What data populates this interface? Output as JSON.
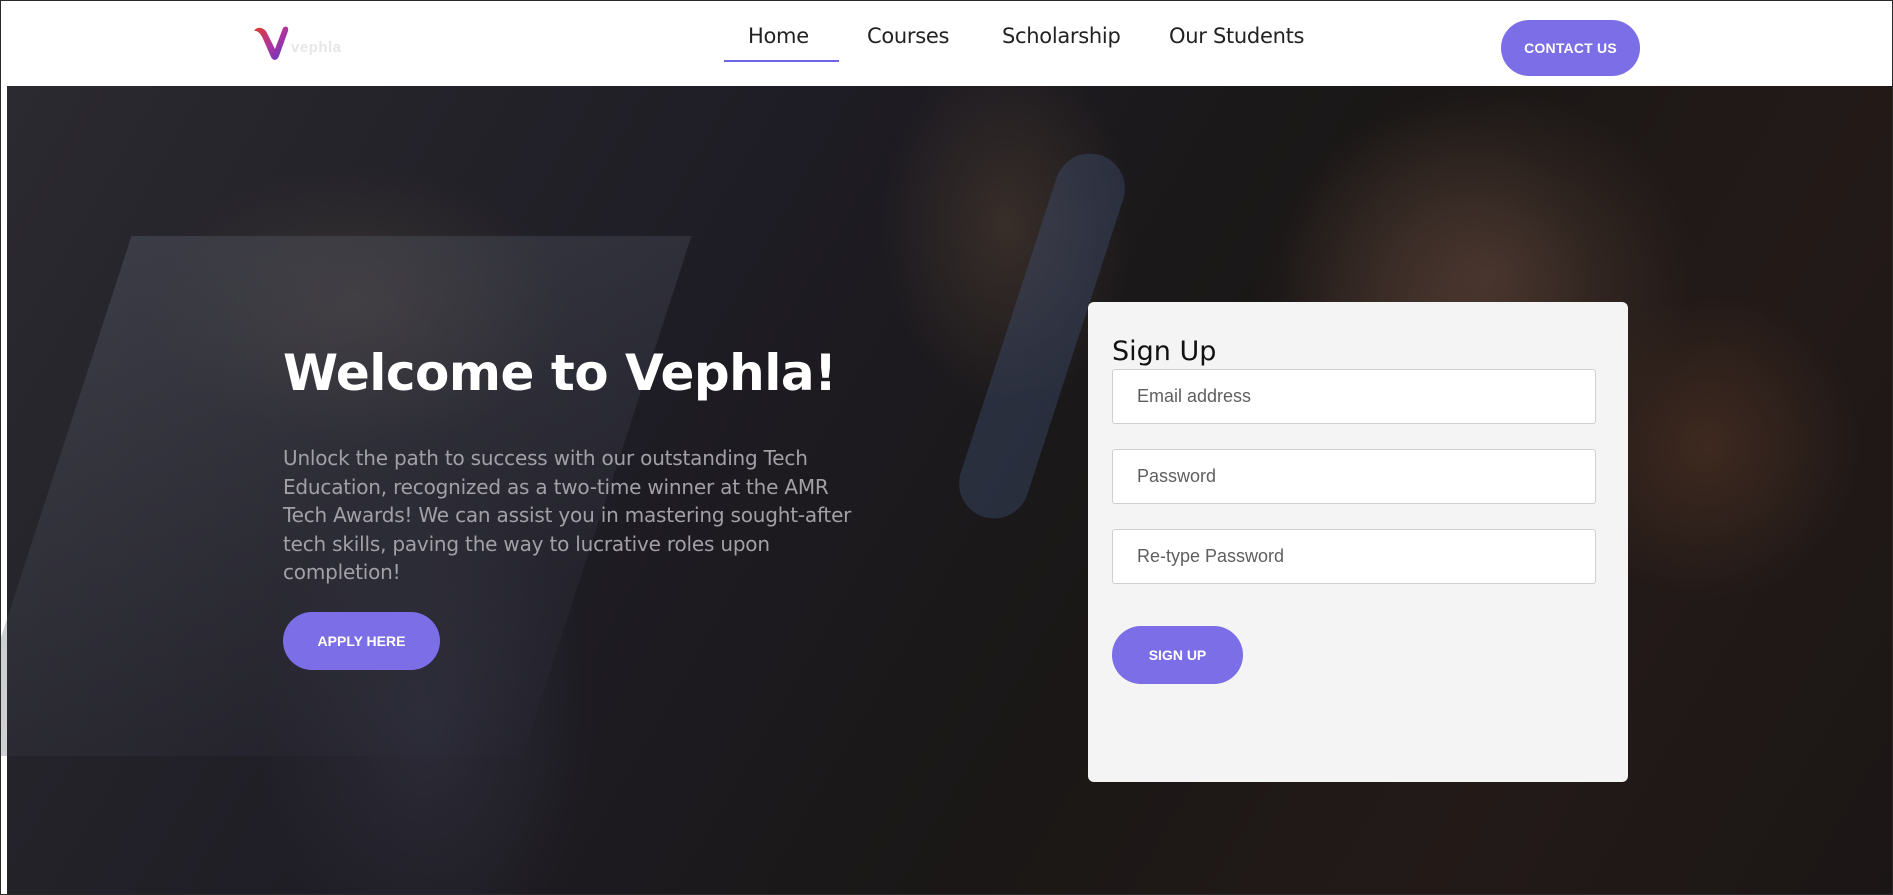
{
  "brand": {
    "name": "vephla",
    "colors": {
      "accent": "#7b6ee6",
      "logo_gradient": [
        "#e0402a",
        "#b0359a",
        "#5b35c9"
      ]
    }
  },
  "nav": {
    "items": [
      {
        "label": "Home",
        "active": true
      },
      {
        "label": "Courses",
        "active": false
      },
      {
        "label": "Scholarship",
        "active": false
      },
      {
        "label": "Our Students",
        "active": false
      }
    ],
    "contact_label": "CONTACT US"
  },
  "hero": {
    "title": "Welcome to Vephla!",
    "description": "Unlock the path to success with our outstanding Tech Education, recognized as a two-time winner at the AMR Tech Awards! We can assist you in mastering sought-after tech skills, paving the way to lucrative roles upon completion!",
    "apply_label": "APPLY HERE"
  },
  "signup": {
    "title": "Sign Up",
    "email_placeholder": "Email address",
    "password_placeholder": "Password",
    "retype_placeholder": "Re-type Password",
    "submit_label": "SIGN UP"
  }
}
